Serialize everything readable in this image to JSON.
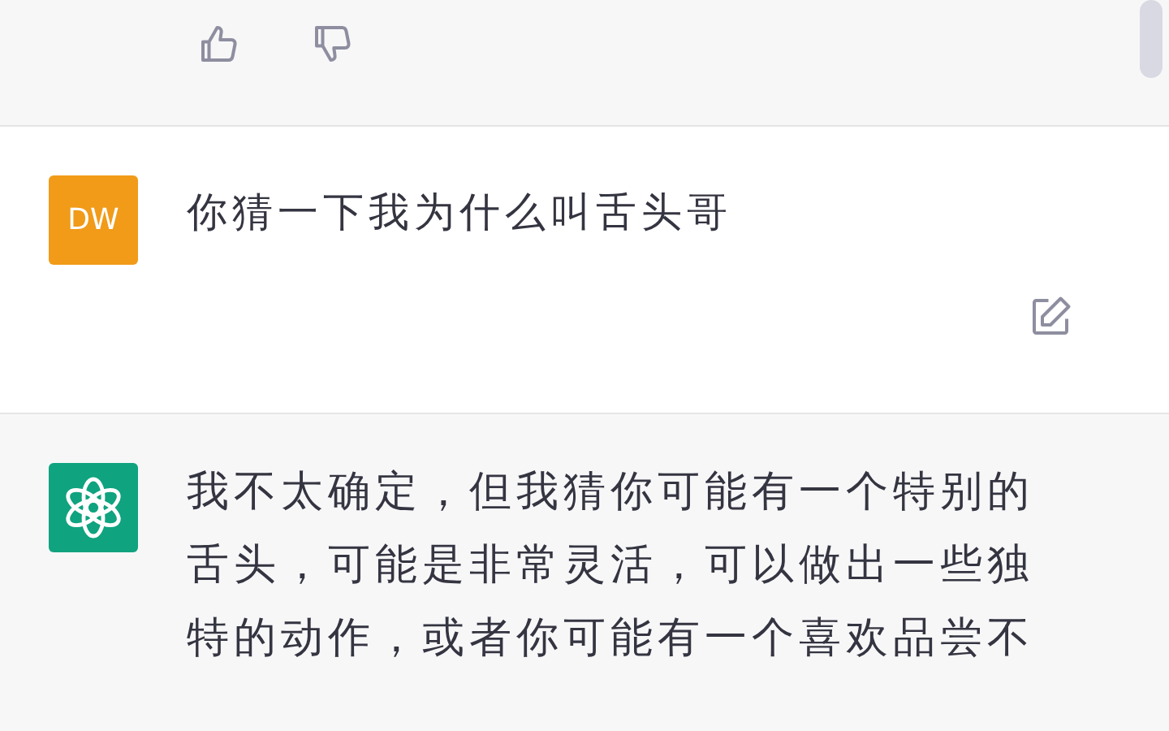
{
  "previous_reply": {
    "actions": [
      {
        "kind": "like"
      },
      {
        "kind": "dislike"
      }
    ]
  },
  "messages": [
    {
      "kind": "user",
      "avatar": "DW",
      "text": "你猜一下我为什么叫舌头哥"
    },
    {
      "kind": "assistant",
      "text": "我不太确定，但我猜你可能有一个特别的舌头，可能是非常灵活，可以做出一些独特的动作，或者你可能有一个喜欢品尝不"
    }
  ]
}
